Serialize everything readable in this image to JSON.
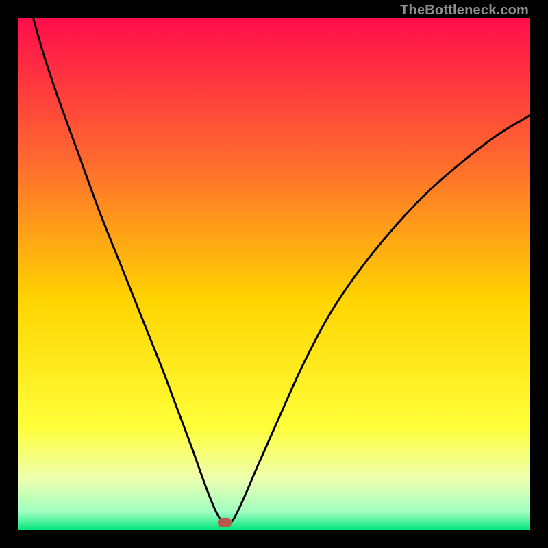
{
  "watermark": "TheBottleneck.com",
  "colors": {
    "top": "#ff0d4b",
    "mid_upper": "#ff7a2a",
    "mid": "#ffe400",
    "lower_yellow": "#f6ff66",
    "pale": "#eaffb0",
    "green": "#00e57a",
    "marker": "#b85a4a",
    "curve": "#000000"
  },
  "marker": {
    "x_frac": 0.404,
    "y_frac": 0.985
  },
  "chart_data": {
    "type": "line",
    "title": "",
    "xlabel": "",
    "ylabel": "",
    "xlim": [
      0,
      100
    ],
    "ylim": [
      0,
      100
    ],
    "series": [
      {
        "name": "bottleneck-curve",
        "x": [
          3,
          5,
          8,
          12,
          16,
          20,
          24,
          28,
          31,
          34,
          36.5,
          38.5,
          40,
          41,
          42,
          44,
          47,
          51,
          56,
          62,
          70,
          80,
          92,
          100
        ],
        "y": [
          100,
          93,
          84,
          73,
          62,
          52,
          42,
          32,
          24,
          16,
          9,
          4,
          1.5,
          1.5,
          2,
          6,
          13,
          22,
          33,
          44,
          55,
          66,
          76,
          81
        ]
      }
    ],
    "annotations": [
      {
        "type": "marker",
        "x": 40.4,
        "y": 1.5,
        "shape": "rounded-rect",
        "color": "#b85a4a"
      }
    ],
    "background_gradient": {
      "stops": [
        {
          "offset": 0.0,
          "color": "#ff0d4b"
        },
        {
          "offset": 0.28,
          "color": "#ff6a2f"
        },
        {
          "offset": 0.55,
          "color": "#ffd400"
        },
        {
          "offset": 0.8,
          "color": "#ffff3a"
        },
        {
          "offset": 0.9,
          "color": "#edffb0"
        },
        {
          "offset": 0.965,
          "color": "#9dffc0"
        },
        {
          "offset": 1.0,
          "color": "#00e57a"
        }
      ]
    }
  }
}
